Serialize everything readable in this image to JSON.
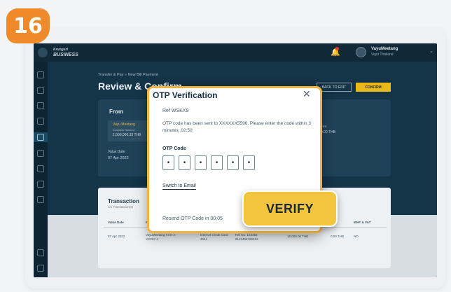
{
  "step": {
    "number": "16",
    "color": "#ee8a2a"
  },
  "app": {
    "brand_top": "Krungsri",
    "brand": "BUSINESS",
    "user_name": "VayuMeetang",
    "user_sub": "Vayu Thailand"
  },
  "page": {
    "breadcrumb": "Transfer & Pay » New Bill Payment",
    "title": "Review & Confirm",
    "back_label": "BACK TO EDIT",
    "confirm_label": "CONFIRM"
  },
  "from": {
    "title": "From",
    "account_name": "Vayu Meetang",
    "account_sub": "Available Balance",
    "account_balance": "1,000,000.33 THB",
    "fee_label": "Fee",
    "fee_value": "0.00 THB",
    "value_date_label": "Value Date",
    "value_date": "07 Apr 2022"
  },
  "transaction": {
    "title": "Transaction",
    "subtitle": "1/1 Transaction(s)",
    "headers": [
      "Value Date",
      "From",
      "WHT & VAT"
    ],
    "row": {
      "date": "07 Apr 2022",
      "from": "VayuMeetang XXX-X-XXX97-4",
      "card": "Internet Credit Card 4041",
      "ref": "Ref No. 123456 8123456789012",
      "amount": "10,000.00 THB",
      "fee": "0.00 THB",
      "wht": "NO"
    }
  },
  "modal": {
    "title": "OTP Verification",
    "close_icon": "close-icon",
    "ref": "Ref WSKX9",
    "message": "OTP code has been sent to XXXXXX5596. Please enter the code within 3 minutes. 02:50",
    "otp_label": "OTP Code",
    "otp_digits": [
      "•",
      "•",
      "•",
      "•",
      "•",
      "•"
    ],
    "switch_label": "Switch to Email",
    "resend": "Resend OTP Code in 00:05",
    "border_color": "#f0b43d"
  },
  "verify_button": {
    "label": "VERIFY",
    "color": "#f3c43d"
  }
}
